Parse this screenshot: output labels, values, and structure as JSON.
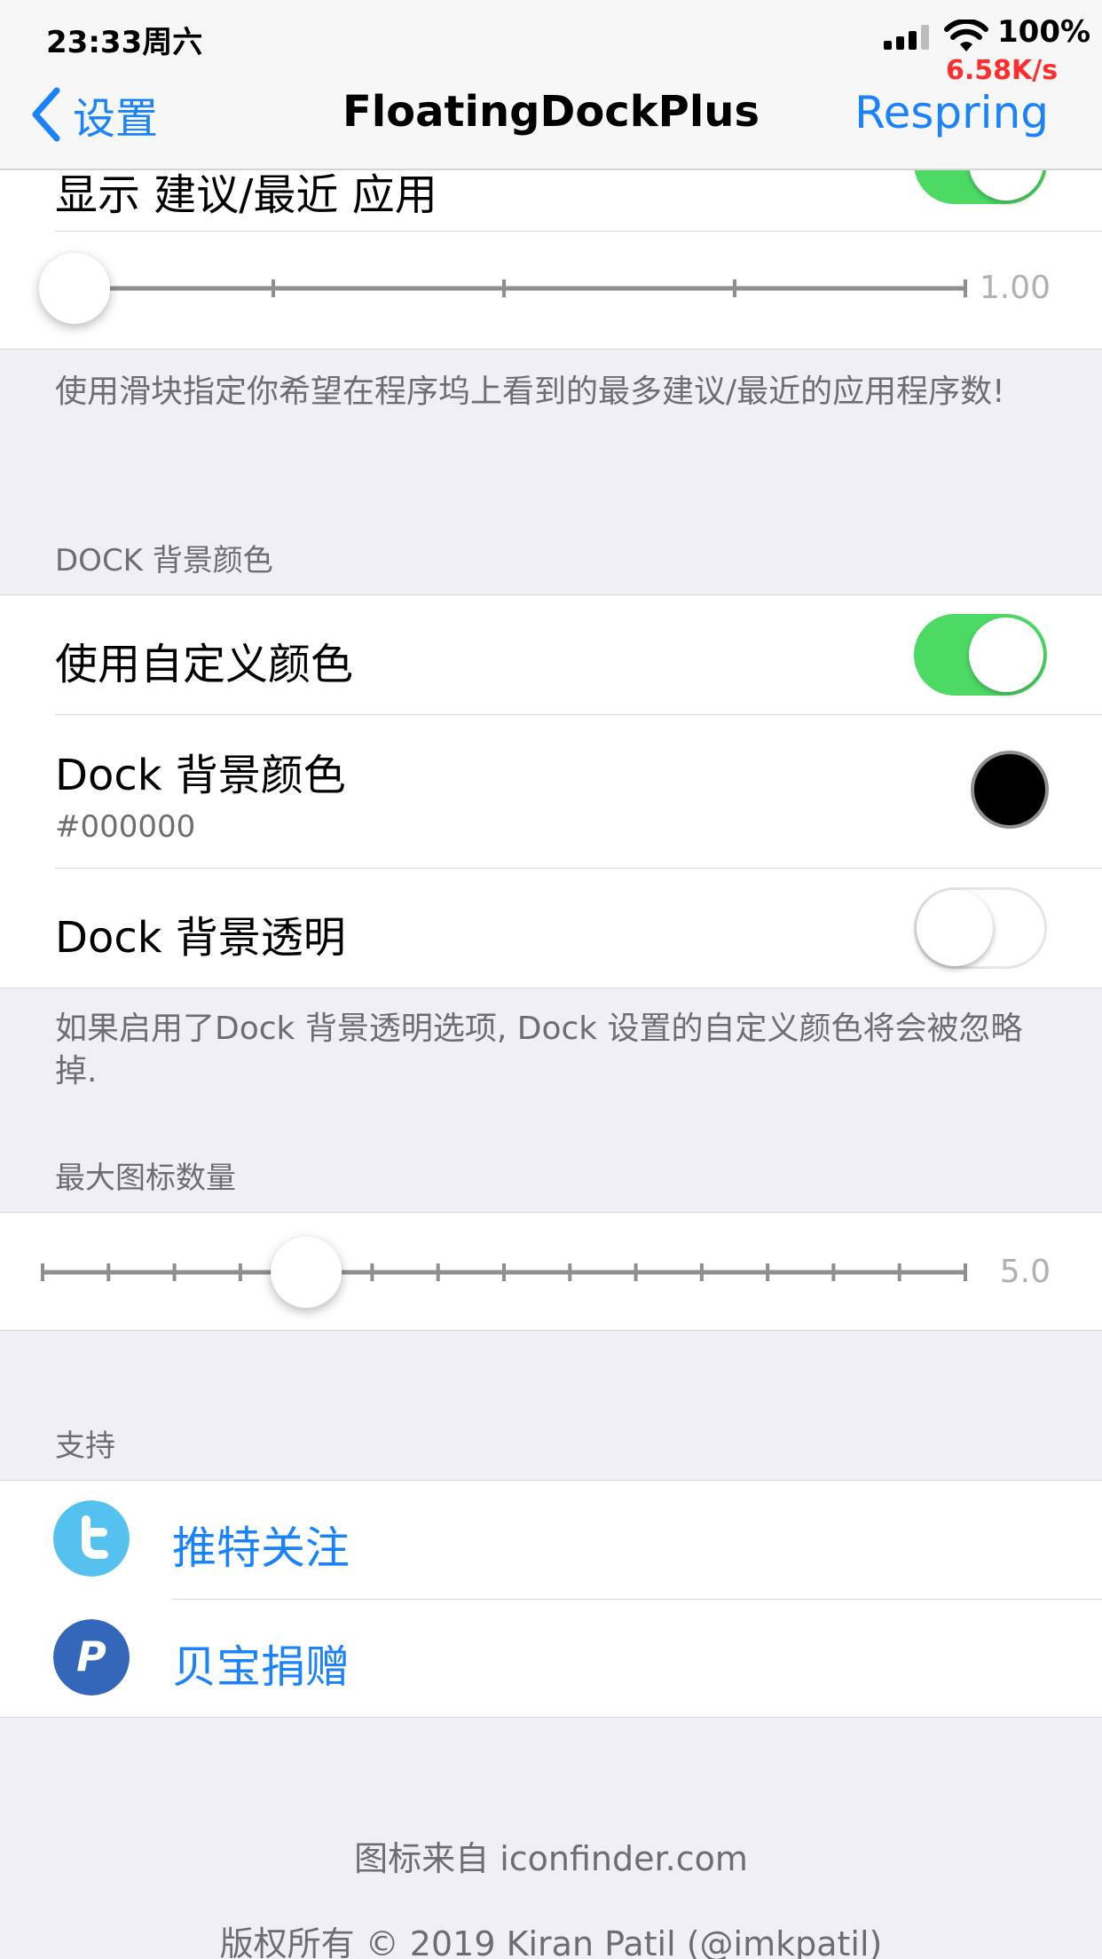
{
  "status_bar": {
    "time": "23:33周六",
    "battery": "100%",
    "net_speed": "6.58K/s"
  },
  "nav": {
    "back_label": "设置",
    "title": "FloatingDockPlus",
    "action_label": "Respring"
  },
  "suggestions_group": {
    "partial_row_label": "显示 建议/最近 应用",
    "partial_row_toggle_on": true,
    "slider": {
      "value": "1.00",
      "min": 1,
      "max": 5,
      "current": 1,
      "ticks": 5
    },
    "footer": "使用滑块指定你希望在程序坞上看到的最多建议/最近的应用程序数!"
  },
  "dock_color_section": {
    "header": "DOCK 背景颜色",
    "rows": [
      {
        "label": "使用自定义颜色",
        "toggle_on": true
      },
      {
        "label": "Dock 背景颜色",
        "subtitle": "#000000",
        "swatch_color": "#000000"
      },
      {
        "label": "Dock 背景透明",
        "toggle_on": false
      }
    ],
    "footer": "如果启用了Dock 背景透明选项, Dock 设置的自定义颜色将会被忽略掉."
  },
  "max_icons_section": {
    "header": "最大图标数量",
    "slider": {
      "value": "5.0",
      "min": 1,
      "max": 15,
      "current": 5,
      "ticks": 15
    }
  },
  "support_section": {
    "header": "支持",
    "links": [
      {
        "label": "推特关注",
        "icon": "twitter-bird-icon",
        "icon_color": "#55c1ee"
      },
      {
        "label": "贝宝捐赠",
        "icon": "paypal-icon",
        "icon_color": "#3267b9"
      }
    ]
  },
  "credits": {
    "icons_credit": "图标来自 iconfinder.com",
    "copyright": "版权所有 © 2019 Kiran Patil (@imkpatil)"
  },
  "colors": {
    "accent": "#1a82fb",
    "switch_on": "#4cd964",
    "background": "#efeff4",
    "net_speed": "#ff2d2d"
  }
}
